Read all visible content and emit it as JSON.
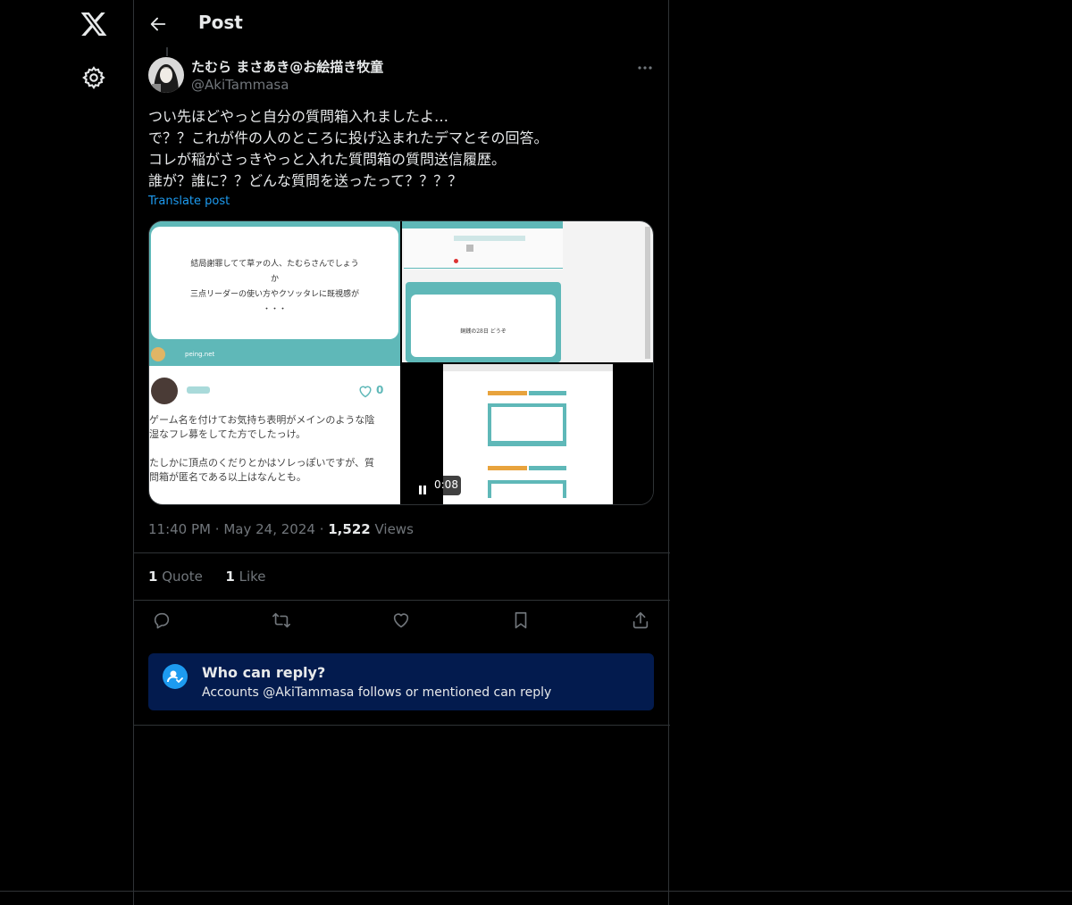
{
  "header": {
    "title": "Post"
  },
  "author": {
    "name": "たむら まさあき@お絵描き牧童",
    "handle": "@AkiTammasa"
  },
  "tweet": {
    "lines": [
      "つい先ほどやっと自分の質問箱入れましたよ…",
      "で？？これが件の人のところに投げ込まれたデマとその回答。",
      "コレが稲がさっきやっと入れた質問箱の質問送信履歴。",
      "誰が？誰に？？どんな質問を送ったって？？？？"
    ],
    "translate": "Translate post"
  },
  "media": {
    "img1": {
      "question_line1": "結局謝罪してて草ァの人、たむらさんでしょう",
      "question_line2": "か",
      "question_line3": "三点リーダーの使い方やクソッタレに既視感が",
      "question_line4": "・・・",
      "site": "peing.net",
      "like_count": "0",
      "answer_line1": "ゲーム名を付けてお気持ち表明がメインのような陰",
      "answer_line2": "湿なフレ募をしてた方でしたっけ。",
      "answer_line3": "たしかに頂点のくだりとかはソレっぽいですが、質",
      "answer_line4": "問箱が匿名である以上はなんとも。"
    },
    "img2": {
      "card_text": "銅銭の28日 どうぞ"
    },
    "video": {
      "time": "0:08"
    }
  },
  "meta": {
    "time": "11:40 PM",
    "sep1": "·",
    "date": "May 24, 2024",
    "sep2": "·",
    "views_count": "1,522",
    "views_label": "Views"
  },
  "stats": {
    "quotes_count": "1",
    "quotes_label": "Quote",
    "likes_count": "1",
    "likes_label": "Like"
  },
  "reply_settings": {
    "title": "Who can reply?",
    "subtitle": "Accounts @AkiTammasa follows or mentioned can reply"
  },
  "colors": {
    "accent": "#1d9bf0",
    "background": "#000000",
    "reply_box": "#031b4e",
    "teal": "#5fb8b8"
  }
}
